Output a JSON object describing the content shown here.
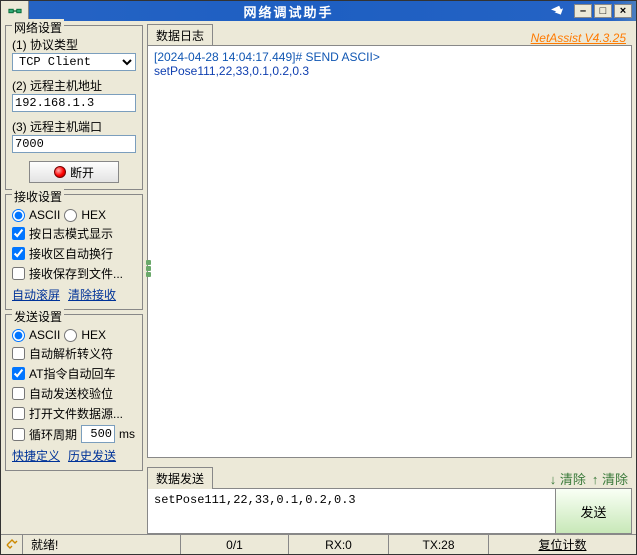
{
  "title": "网络调试助手",
  "brand": "NetAssist V4.3.25",
  "network": {
    "group": "网络设置",
    "proto_label": "(1) 协议类型",
    "proto_value": "TCP Client",
    "host_label": "(2) 远程主机地址",
    "host_value": "192.168.1.3",
    "port_label": "(3) 远程主机端口",
    "port_value": "7000",
    "disconnect": "断开"
  },
  "recv": {
    "group": "接收设置",
    "ascii": "ASCII",
    "hex": "HEX",
    "c1": "按日志模式显示",
    "c2": "接收区自动换行",
    "c3": "接收保存到文件...",
    "link1": "自动滚屏",
    "link2": "清除接收"
  },
  "send": {
    "group": "发送设置",
    "ascii": "ASCII",
    "hex": "HEX",
    "c1": "自动解析转义符",
    "c2": "AT指令自动回车",
    "c3": "自动发送校验位",
    "c4": "打开文件数据源...",
    "cycle": "循环周期",
    "cycle_val": "500",
    "ms": "ms",
    "link1": "快捷定义",
    "link2": "历史发送"
  },
  "log": {
    "tab": "数据日志",
    "l1": "[2024-04-28 14:04:17.449]# SEND ASCII>",
    "l2": "setPose111,22,33,0.1,0.2,0.3"
  },
  "sendpanel": {
    "tab": "数据发送",
    "clear_l": "↓ 清除",
    "clear_r": "↑ 清除",
    "value": "setPose111,22,33,0.1,0.2,0.3",
    "btn": "发送"
  },
  "status": {
    "ready": "就绪!",
    "cnt": "0/1",
    "rx": "RX:0",
    "tx": "TX:28",
    "reset": "复位计数"
  }
}
